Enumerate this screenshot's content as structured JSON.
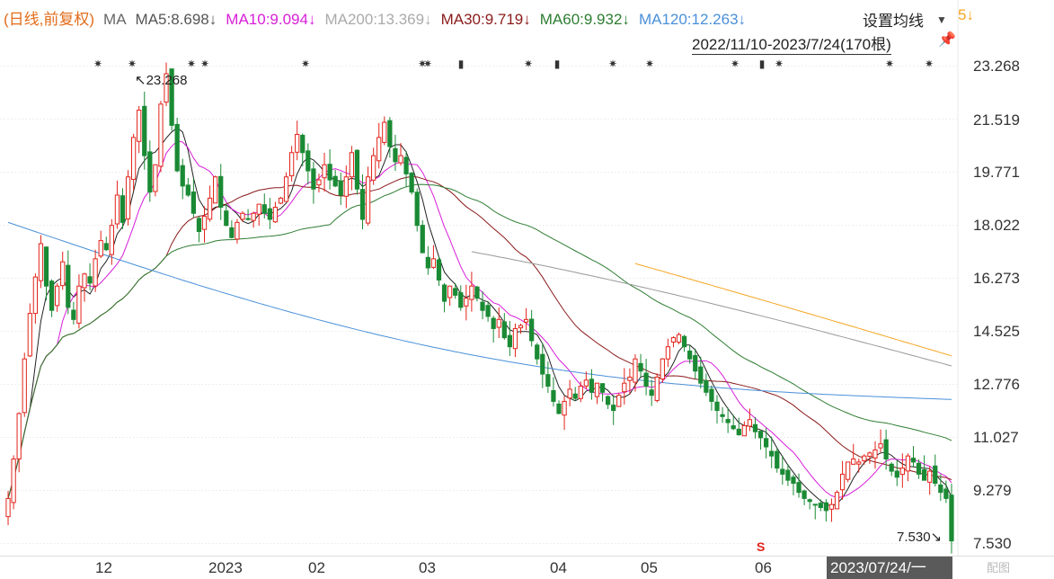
{
  "legend": {
    "title": "(日线,前复权)",
    "ma_label": "MA",
    "ma5": "MA5:8.698↓",
    "ma10": "MA10:9.094↓",
    "ma200": "MA200:13.369↓",
    "ma30": "MA30:9.719↓",
    "ma60": "MA60:9.932↓",
    "ma120": "MA120:12.263↓",
    "cut": "5↓"
  },
  "settings_label": "设置均线",
  "caret": "▼",
  "range_label": "2022/11/10-2023/7/24(170根)",
  "pin_icon": "📌",
  "high_label": "↖23.268",
  "low_label": "7.530↘",
  "s_marker": "S",
  "watermark": "配图",
  "x_selected": "2023/07/24/一",
  "colors": {
    "up": "#e2231a",
    "down": "#1a8a34",
    "ma5": "#222222",
    "ma10": "#d81ed8",
    "ma30": "#8b1a1a",
    "ma60": "#2e7d32",
    "ma120": "#4a90d9",
    "ma200": "#999999",
    "ma250": "#f5a623"
  },
  "chart_data": {
    "type": "candlestick",
    "y_ticks": [
      "23.268",
      "21.519",
      "19.771",
      "18.022",
      "16.273",
      "14.525",
      "12.776",
      "11.027",
      "9.279",
      "7.530"
    ],
    "x_ticks": [
      "12",
      "2023",
      "02",
      "03",
      "04",
      "05",
      "06"
    ],
    "ylim": [
      7.53,
      23.268
    ],
    "grid": true,
    "high": 23.268,
    "low": 7.53,
    "series": [
      {
        "name": "MA5",
        "last": 8.698
      },
      {
        "name": "MA10",
        "last": 9.094
      },
      {
        "name": "MA30",
        "last": 9.719
      },
      {
        "name": "MA60",
        "last": 9.932
      },
      {
        "name": "MA120",
        "last": 12.263
      },
      {
        "name": "MA200",
        "last": 13.369
      }
    ],
    "close": [
      9.0,
      10.3,
      11.8,
      13.6,
      15.1,
      16.3,
      17.4,
      16.0,
      15.2,
      16.0,
      16.8,
      15.3,
      14.9,
      16.0,
      16.4,
      16.1,
      16.9,
      17.5,
      17.2,
      18.0,
      19.0,
      18.1,
      19.6,
      20.9,
      21.8,
      20.3,
      19.1,
      20.0,
      22.0,
      23.0,
      21.3,
      19.8,
      19.3,
      19.0,
      18.4,
      17.8,
      18.3,
      18.9,
      19.6,
      18.6,
      18.0,
      17.6,
      18.1,
      18.4,
      18.2,
      18.4,
      18.7,
      18.4,
      18.2,
      18.6,
      18.9,
      19.6,
      20.4,
      21.0,
      20.4,
      19.8,
      19.2,
      19.5,
      20.0,
      19.5,
      19.3,
      19.0,
      19.6,
      20.4,
      19.2,
      18.2,
      19.6,
      20.3,
      20.9,
      21.4,
      20.6,
      20.1,
      20.3,
      19.7,
      19.1,
      18.0,
      17.1,
      16.6,
      16.9,
      16.2,
      15.5,
      16.0,
      15.7,
      15.3,
      15.6,
      16.0,
      15.6,
      15.2,
      15.0,
      14.6,
      14.9,
      14.3,
      14.0,
      14.6,
      14.7,
      14.9,
      14.2,
      13.6,
      13.1,
      12.7,
      12.2,
      11.8,
      12.2,
      12.6,
      12.3,
      12.7,
      12.9,
      12.5,
      12.8,
      12.5,
      12.1,
      11.9,
      12.4,
      12.8,
      13.0,
      13.6,
      13.2,
      12.7,
      12.4,
      13.0,
      13.6,
      14.0,
      14.3,
      14.4,
      14.0,
      13.6,
      13.2,
      12.8,
      12.5,
      12.2,
      11.9,
      11.7,
      11.5,
      11.3,
      11.1,
      11.4,
      11.6,
      11.2,
      11.0,
      10.7,
      10.4,
      10.0,
      9.8,
      9.6,
      9.5,
      9.2,
      9.0,
      8.9,
      8.8,
      8.7,
      8.6,
      8.8,
      9.2,
      9.8,
      10.2,
      10.3,
      10.2,
      10.4,
      10.5,
      10.6,
      10.8,
      10.3,
      9.9,
      9.7,
      10.0,
      10.4,
      10.2,
      9.8,
      9.6,
      9.9,
      9.5,
      9.2,
      9.0,
      7.6
    ]
  }
}
